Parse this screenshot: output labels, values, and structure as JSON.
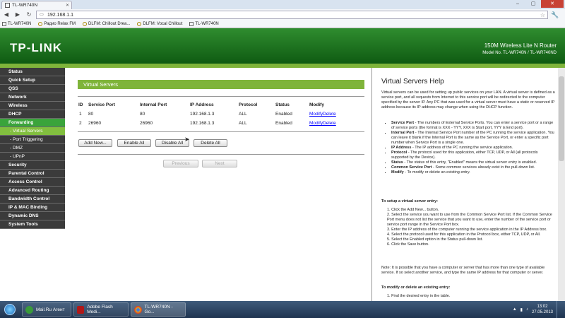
{
  "browser": {
    "tab_title": "TL-WR740N",
    "url": "192.168.1.1",
    "bookmarks": [
      "TL-WR740N",
      "Радио Relax FM",
      "DLFM: Chillout Drea...",
      "DLFM: Vocal Chillout",
      "TL-WR740N"
    ]
  },
  "router": {
    "logo": "TP-LINK",
    "product": "150M Wireless Lite N Router",
    "model": "Model No. TL-WR740N / TL-WR740ND",
    "menu": [
      {
        "label": "Status",
        "state": "normal"
      },
      {
        "label": "Quick Setup",
        "state": "normal"
      },
      {
        "label": "QSS",
        "state": "normal"
      },
      {
        "label": "Network",
        "state": "normal"
      },
      {
        "label": "Wireless",
        "state": "normal"
      },
      {
        "label": "DHCP",
        "state": "normal"
      },
      {
        "label": "Forwarding",
        "state": "active"
      },
      {
        "label": "- Virtual Servers",
        "state": "sub-active"
      },
      {
        "label": "- Port Triggering",
        "state": "sub"
      },
      {
        "label": "- DMZ",
        "state": "sub"
      },
      {
        "label": "- UPnP",
        "state": "sub"
      },
      {
        "label": "Security",
        "state": "normal"
      },
      {
        "label": "Parental Control",
        "state": "normal"
      },
      {
        "label": "Access Control",
        "state": "normal"
      },
      {
        "label": "Advanced Routing",
        "state": "normal"
      },
      {
        "label": "Bandwidth Control",
        "state": "normal"
      },
      {
        "label": "IP & MAC Binding",
        "state": "normal"
      },
      {
        "label": "Dynamic DNS",
        "state": "normal"
      },
      {
        "label": "System Tools",
        "state": "normal"
      }
    ]
  },
  "virtual_servers": {
    "title": "Virtual Servers",
    "headers": [
      "ID",
      "Service Port",
      "Internal Port",
      "IP Address",
      "Protocol",
      "Status",
      "Modify"
    ],
    "rows": [
      {
        "id": "1",
        "service_port": "80",
        "internal_port": "80",
        "ip": "192.168.1.3",
        "protocol": "ALL",
        "status": "Enabled"
      },
      {
        "id": "2",
        "service_port": "26960",
        "internal_port": "26960",
        "ip": "192.168.1.3",
        "protocol": "ALL",
        "status": "Enabled"
      }
    ],
    "modify_label": "Modify",
    "delete_label": "Delete",
    "buttons": {
      "add": "Add New...",
      "enable_all": "Enable All",
      "disable_all": "Disable All",
      "delete_all": "Delete All"
    },
    "pager": {
      "previous": "Previous",
      "next": "Next"
    }
  },
  "help": {
    "title": "Virtual Servers Help",
    "intro": "Virtual servers can be used for setting up public services on your LAN. A virtual server is defined as a service port, and all requests from Internet to this service port will be redirected to the computer specified by the server IP. Any PC that was used for a virtual server must have a static or reserved IP address because its IP address may change when using the DHCP function.",
    "items": [
      {
        "term": "Service Port",
        "text": " - The numbers of External Service Ports. You can enter a service port or a range of service ports (the format is XXX - YYY, XXX is Start port, YYY is End port)."
      },
      {
        "term": "Internal Port",
        "text": " - The Internal Service Port number of the PC running the service application. You can leave it blank if the Internal Port is the same as the Service Port, or enter a specific port number when Service Port is a single one."
      },
      {
        "term": "IP Address",
        "text": " - The IP address of the PC running the service application."
      },
      {
        "term": "Protocol",
        "text": " - The protocol used for this application, either TCP, UDP, or All (all protocols supported by the Device)."
      },
      {
        "term": "Status",
        "text": " - The status of this entry, \"Enabled\" means the virtual server entry is enabled."
      },
      {
        "term": "Common Service Port",
        "text": " - Some common services already exist in the pull-down list."
      },
      {
        "term": "Modify",
        "text": " - To modify or delete an existing entry."
      }
    ],
    "setup_title": "To setup a virtual server entry:",
    "steps": [
      "1. Click the Add New... button.",
      "2. Select the service you want to use from the Common Service Port list. If the Common Service Port menu does not list the service that you want to use, enter the number of the service port or service port range in the Service Port box.",
      "3. Enter the IP address of the computer running the service application in the IP Address box.",
      "4. Select the protocol used for this application in the Protocol box, either TCP, UDP, or All.",
      "5. Select the Enabled option in the Status pull-down list.",
      "6. Click the Save button."
    ],
    "note": "Note: It is possible that you have a computer or server that has more than one type of available service. If so select another service, and type the same IP address for that computer or server.",
    "modify_title": "To modify or delete an existing entry:",
    "modify_steps": [
      "1. Find the desired entry in the table."
    ]
  },
  "taskbar": {
    "items": [
      "Mail.Ru Агент",
      "Adobe Flash Medi...",
      "TL-WR740N - Go..."
    ],
    "time": "13:02",
    "date": "27.05.2013"
  }
}
